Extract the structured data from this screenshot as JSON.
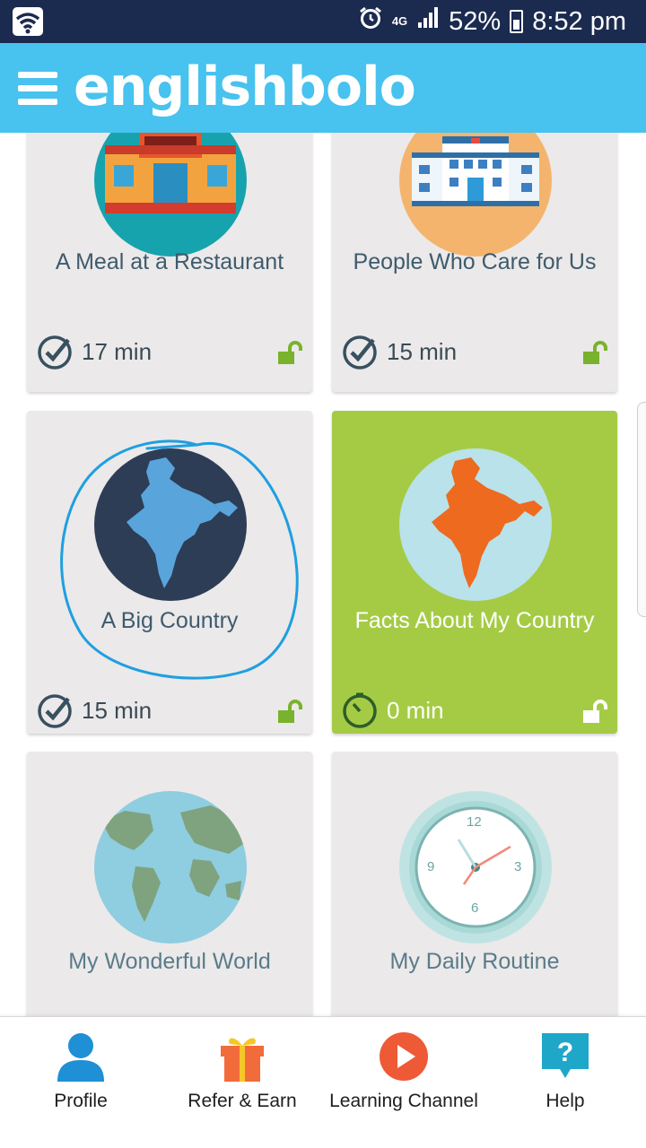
{
  "status_bar": {
    "network": "4G",
    "battery": "52%",
    "time": "8:52 pm"
  },
  "app": {
    "logo_text": "englishbolo",
    "accent_color": "#48c2ee"
  },
  "cards": [
    {
      "title": "A Meal at a Restaurant",
      "duration": "17 min",
      "icon": "restaurant-illustration",
      "state": "completed",
      "lock": "unlocked"
    },
    {
      "title": "People Who Care for Us",
      "duration": "15 min",
      "icon": "hospital-illustration",
      "state": "completed",
      "lock": "unlocked"
    },
    {
      "title": "A Big Country",
      "duration": "15 min",
      "icon": "india-map-illustration",
      "state": "completed",
      "lock": "unlocked"
    },
    {
      "title": "Facts About My Country",
      "duration": "0 min",
      "icon": "india-map-illustration",
      "state": "current",
      "lock": "unlocked"
    },
    {
      "title": "My Wonderful World",
      "duration": "",
      "icon": "globe-illustration",
      "state": "upcoming",
      "lock": ""
    },
    {
      "title": "My Daily Routine",
      "duration": "",
      "icon": "clock-illustration",
      "state": "upcoming",
      "lock": ""
    }
  ],
  "clock_face": {
    "n12": "12",
    "n3": "3",
    "n6": "6",
    "n9": "9"
  },
  "bottom_nav": [
    {
      "label": "Profile",
      "icon": "profile-icon",
      "color": "#1f8fd6"
    },
    {
      "label": "Refer & Earn",
      "icon": "gift-icon",
      "color": "#f26b3a"
    },
    {
      "label": "Learning Channel",
      "icon": "play-icon",
      "color": "#ee5a36"
    },
    {
      "label": "Help",
      "icon": "help-icon",
      "color": "#1fa7c9"
    }
  ]
}
